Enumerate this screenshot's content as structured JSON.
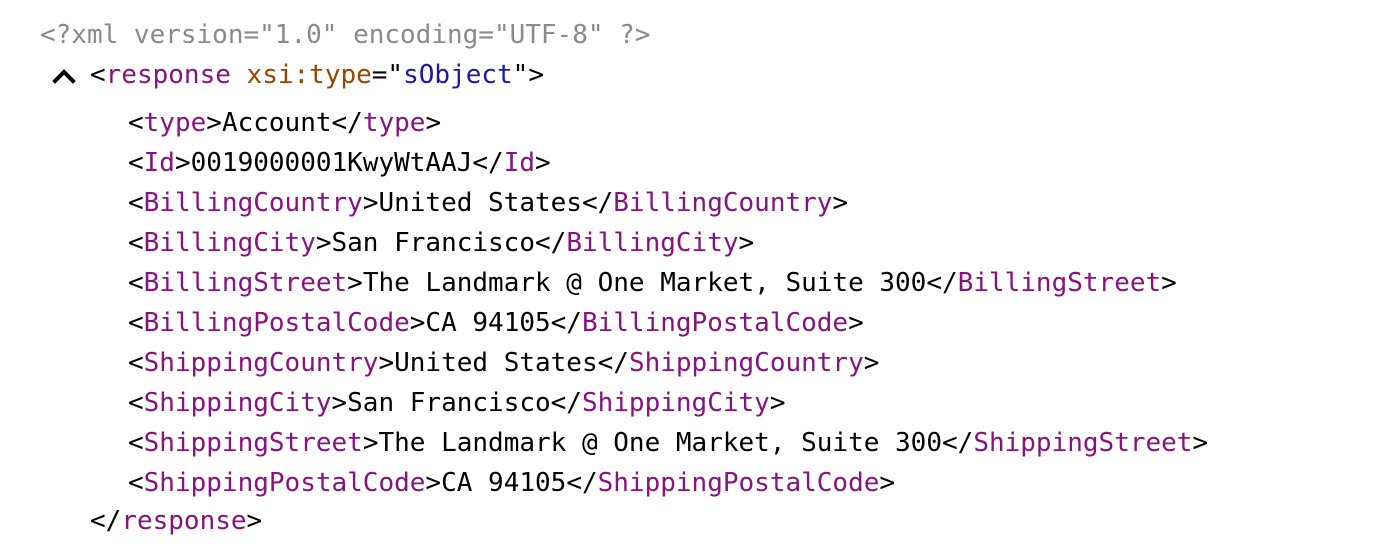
{
  "declaration": "<?xml version=\"1.0\" encoding=\"UTF-8\" ?>",
  "root": {
    "tag": "response",
    "attr_name": "xsi:type",
    "attr_value": "sObject",
    "collapse_icon": "chevron-up-icon"
  },
  "fields": [
    {
      "tag": "type",
      "value": "Account"
    },
    {
      "tag": "Id",
      "value": "0019000001KwyWtAAJ"
    },
    {
      "tag": "BillingCountry",
      "value": "United States"
    },
    {
      "tag": "BillingCity",
      "value": "San Francisco"
    },
    {
      "tag": "BillingStreet",
      "value": "The Landmark @ One Market, Suite 300"
    },
    {
      "tag": "BillingPostalCode",
      "value": "CA 94105"
    },
    {
      "tag": "ShippingCountry",
      "value": "United States"
    },
    {
      "tag": "ShippingCity",
      "value": "San Francisco"
    },
    {
      "tag": "ShippingStreet",
      "value": "The Landmark @ One Market, Suite 300"
    },
    {
      "tag": "ShippingPostalCode",
      "value": "CA 94105"
    }
  ],
  "colors": {
    "tag": "#881280",
    "attr_name": "#994500",
    "attr_value": "#1a1aa6",
    "declaration": "#8a8a8a"
  }
}
